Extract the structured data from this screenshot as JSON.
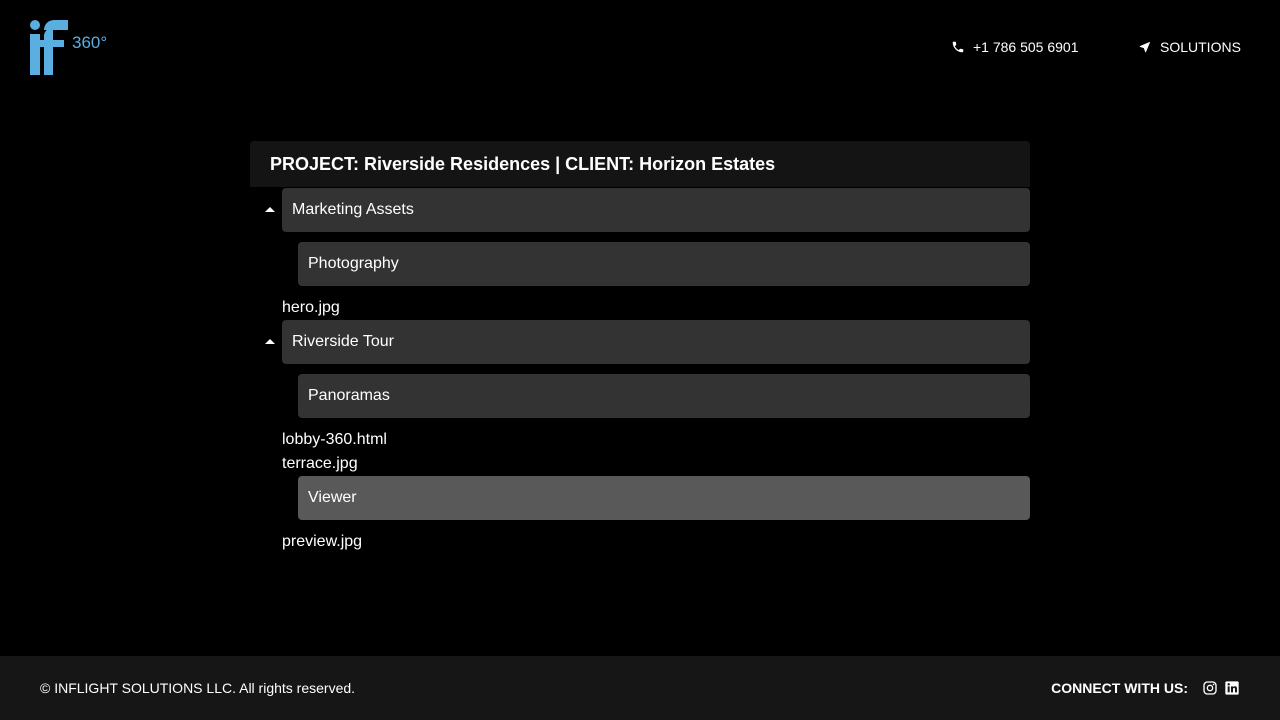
{
  "brand": {
    "logo_text": "360°",
    "accent": "#5aaee0"
  },
  "header": {
    "phone": "+1 786 505 6901",
    "phone_icon": "phone-icon",
    "solutions": "SOLUTIONS",
    "solutions_icon": "navigation-arrow-icon"
  },
  "project": {
    "title": "PROJECT: Riverside Residences | CLIENT: Horizon Estates",
    "tree": [
      {
        "type": "folder",
        "level": 1,
        "label": "Marketing Assets",
        "expanded": true
      },
      {
        "type": "folder",
        "level": 2,
        "label": "Photography"
      },
      {
        "type": "file",
        "label": "hero.jpg"
      },
      {
        "type": "folder",
        "level": 1,
        "label": "Riverside Tour",
        "expanded": true
      },
      {
        "type": "folder",
        "level": 2,
        "label": "Panoramas"
      },
      {
        "type": "file",
        "label": "lobby-360.html"
      },
      {
        "type": "file",
        "label": "terrace.jpg"
      },
      {
        "type": "folder",
        "level": 2,
        "label": "Viewer",
        "active": true
      },
      {
        "type": "file",
        "label": "preview.jpg"
      }
    ]
  },
  "footer": {
    "copyright": "© INFLIGHT SOLUTIONS LLC. All rights reserved.",
    "connect_label": "CONNECT WITH US:",
    "social": [
      "instagram-icon",
      "linkedin-icon"
    ]
  }
}
